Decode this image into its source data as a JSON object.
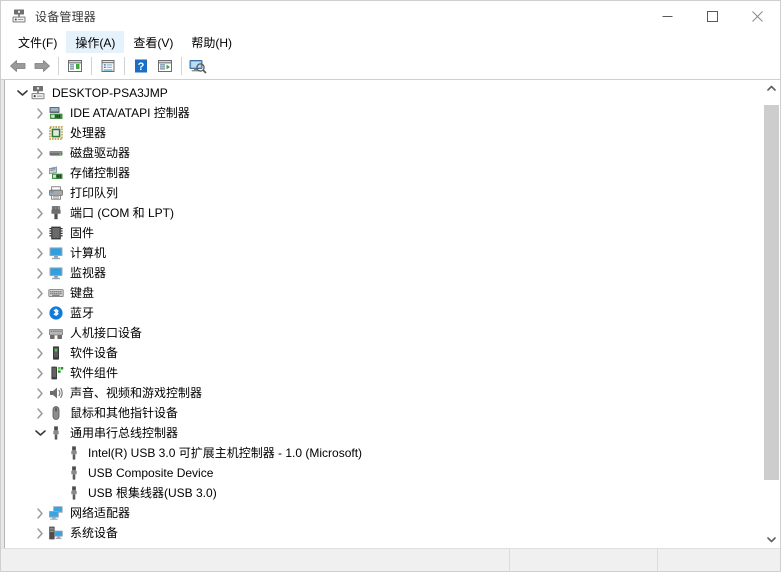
{
  "window": {
    "title": "设备管理器",
    "title_icon": "device-manager-icon"
  },
  "window_controls": {
    "minimize": "minimize-icon",
    "maximize": "maximize-icon",
    "close": "close-icon"
  },
  "menubar": {
    "items": [
      {
        "label": "文件(F)",
        "active": false
      },
      {
        "label": "操作(A)",
        "active": true
      },
      {
        "label": "查看(V)",
        "active": false
      },
      {
        "label": "帮助(H)",
        "active": false
      }
    ]
  },
  "toolbar": {
    "buttons": [
      {
        "name": "back-icon",
        "tip": "后退"
      },
      {
        "name": "forward-icon",
        "tip": "前进"
      },
      {
        "name": "separator",
        "tip": ""
      },
      {
        "name": "show-hide-console-tree-icon",
        "tip": "显示/隐藏控制台树"
      },
      {
        "name": "separator",
        "tip": ""
      },
      {
        "name": "properties-icon",
        "tip": "属性"
      },
      {
        "name": "separator",
        "tip": ""
      },
      {
        "name": "help-icon",
        "tip": "帮助"
      },
      {
        "name": "update-driver-icon",
        "tip": "更新驱动程序"
      },
      {
        "name": "separator",
        "tip": ""
      },
      {
        "name": "scan-hardware-changes-icon",
        "tip": "扫描检测硬件改动"
      }
    ]
  },
  "tree": {
    "nodes": [
      {
        "label": "DESKTOP-PSA3JMP",
        "depth": 0,
        "state": "expanded",
        "icon": "computer-root-icon"
      },
      {
        "label": "IDE ATA/ATAPI 控制器",
        "depth": 1,
        "state": "collapsed",
        "icon": "ide-controller-icon"
      },
      {
        "label": "处理器",
        "depth": 1,
        "state": "collapsed",
        "icon": "processor-icon"
      },
      {
        "label": "磁盘驱动器",
        "depth": 1,
        "state": "collapsed",
        "icon": "disk-drive-icon"
      },
      {
        "label": "存储控制器",
        "depth": 1,
        "state": "collapsed",
        "icon": "storage-controller-icon"
      },
      {
        "label": "打印队列",
        "depth": 1,
        "state": "collapsed",
        "icon": "printer-queue-icon"
      },
      {
        "label": "端口 (COM 和 LPT)",
        "depth": 1,
        "state": "collapsed",
        "icon": "port-icon"
      },
      {
        "label": "固件",
        "depth": 1,
        "state": "collapsed",
        "icon": "firmware-icon"
      },
      {
        "label": "计算机",
        "depth": 1,
        "state": "collapsed",
        "icon": "computer-icon"
      },
      {
        "label": "监视器",
        "depth": 1,
        "state": "collapsed",
        "icon": "monitor-icon"
      },
      {
        "label": "键盘",
        "depth": 1,
        "state": "collapsed",
        "icon": "keyboard-icon"
      },
      {
        "label": "蓝牙",
        "depth": 1,
        "state": "collapsed",
        "icon": "bluetooth-icon"
      },
      {
        "label": "人机接口设备",
        "depth": 1,
        "state": "collapsed",
        "icon": "hid-icon"
      },
      {
        "label": "软件设备",
        "depth": 1,
        "state": "collapsed",
        "icon": "software-device-icon"
      },
      {
        "label": "软件组件",
        "depth": 1,
        "state": "collapsed",
        "icon": "software-component-icon"
      },
      {
        "label": "声音、视频和游戏控制器",
        "depth": 1,
        "state": "collapsed",
        "icon": "sound-video-game-icon"
      },
      {
        "label": "鼠标和其他指针设备",
        "depth": 1,
        "state": "collapsed",
        "icon": "mouse-icon"
      },
      {
        "label": "通用串行总线控制器",
        "depth": 1,
        "state": "expanded",
        "icon": "usb-icon"
      },
      {
        "label": "Intel(R) USB 3.0 可扩展主机控制器 - 1.0 (Microsoft)",
        "depth": 2,
        "state": "leaf",
        "icon": "usb-icon"
      },
      {
        "label": "USB Composite Device",
        "depth": 2,
        "state": "leaf",
        "icon": "usb-icon"
      },
      {
        "label": "USB 根集线器(USB 3.0)",
        "depth": 2,
        "state": "leaf",
        "icon": "usb-icon"
      },
      {
        "label": "网络适配器",
        "depth": 1,
        "state": "collapsed",
        "icon": "network-adapter-icon"
      },
      {
        "label": "系统设备",
        "depth": 1,
        "state": "collapsed",
        "icon": "system-device-icon"
      }
    ]
  },
  "scrollbar": {
    "up_icon": "scroll-up-arrow-icon",
    "down_icon": "scroll-down-arrow-icon"
  },
  "statusbar": {
    "pane1": "",
    "pane2": "",
    "pane3": ""
  },
  "colors": {
    "accent": "#0078d7",
    "menu_hover": "#e5f1fb",
    "row_hover": "#e5f3fb",
    "status_bg": "#f0f0f0",
    "scroll_thumb": "#cdcdcd"
  }
}
